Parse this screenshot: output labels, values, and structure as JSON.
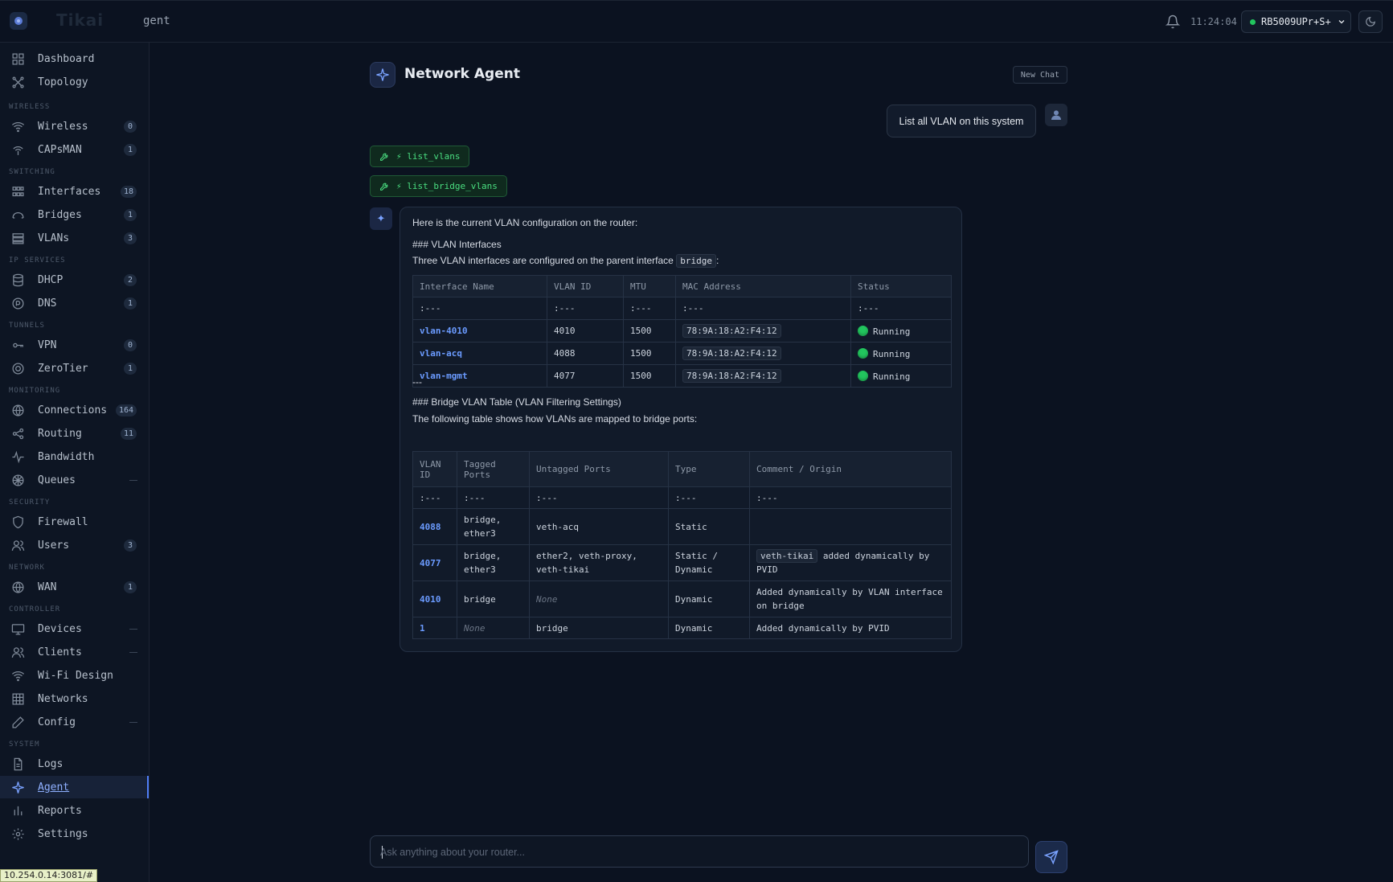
{
  "app": {
    "logo_text": "Tikai",
    "breadcrumb": "gent",
    "clock": "11:24:04",
    "device": "RB5009UPr+S+"
  },
  "sidebar": {
    "top_items": [
      {
        "label": "Dashboard",
        "icon": "dashboard-icon"
      },
      {
        "label": "Topology",
        "icon": "topology-icon"
      }
    ],
    "sections": [
      {
        "title": "WIRELESS",
        "items": [
          {
            "label": "Wireless",
            "count": "0",
            "icon": "wifi-icon"
          },
          {
            "label": "CAPsMAN",
            "count": "1",
            "icon": "antenna-icon"
          }
        ]
      },
      {
        "title": "SWITCHING",
        "items": [
          {
            "label": "Interfaces",
            "count": "18",
            "icon": "interfaces-icon"
          },
          {
            "label": "Bridges",
            "count": "1",
            "icon": "bridge-icon"
          },
          {
            "label": "VLANs",
            "count": "3",
            "icon": "vlan-icon"
          }
        ]
      },
      {
        "title": "IP SERVICES",
        "items": [
          {
            "label": "DHCP",
            "count": "2",
            "icon": "database-icon"
          },
          {
            "label": "DNS",
            "count": "1",
            "icon": "dns-icon"
          }
        ]
      },
      {
        "title": "TUNNELS",
        "items": [
          {
            "label": "VPN",
            "count": "0",
            "icon": "key-icon"
          },
          {
            "label": "ZeroTier",
            "count": "1",
            "icon": "target-icon"
          }
        ]
      },
      {
        "title": "MONITORING",
        "items": [
          {
            "label": "Connections",
            "count": "164",
            "icon": "globe-icon"
          },
          {
            "label": "Routing",
            "count": "11",
            "icon": "share-icon"
          },
          {
            "label": "Bandwidth",
            "count": "",
            "icon": "activity-icon"
          },
          {
            "label": "Queues",
            "count": "—",
            "icon": "queue-icon"
          }
        ]
      },
      {
        "title": "SECURITY",
        "items": [
          {
            "label": "Firewall",
            "count": "",
            "icon": "shield-icon"
          },
          {
            "label": "Users",
            "count": "3",
            "icon": "users-icon"
          }
        ]
      },
      {
        "title": "NETWORK",
        "items": [
          {
            "label": "WAN",
            "count": "1",
            "icon": "globe-icon"
          }
        ]
      },
      {
        "title": "CONTROLLER",
        "items": [
          {
            "label": "Devices",
            "count": "—",
            "icon": "monitor-icon"
          },
          {
            "label": "Clients",
            "count": "—",
            "icon": "users-icon"
          },
          {
            "label": "Wi-Fi Design",
            "count": "",
            "icon": "wifi-icon"
          },
          {
            "label": "Networks",
            "count": "",
            "icon": "grid-icon"
          },
          {
            "label": "Config",
            "count": "—",
            "icon": "pen-icon"
          }
        ]
      },
      {
        "title": "SYSTEM",
        "items": [
          {
            "label": "Logs",
            "count": "",
            "icon": "file-icon"
          },
          {
            "label": "Agent",
            "count": "",
            "icon": "sparkle-icon",
            "active": true
          },
          {
            "label": "Reports",
            "count": "",
            "icon": "bar-chart-icon"
          },
          {
            "label": "Settings",
            "count": "",
            "icon": "gear-icon"
          }
        ]
      }
    ],
    "status_url": "10.254.0.14:3081/#"
  },
  "chat": {
    "title": "Network Agent",
    "new_chat": "New Chat",
    "user_message": "List all VLAN on this system",
    "tool_calls": [
      "⚡ list_vlans",
      "⚡ list_bridge_vlans"
    ],
    "reply": {
      "intro": "Here is the current VLAN configuration on the router:",
      "h1": "### VLAN Interfaces",
      "p1_pre": "Three VLAN interfaces are configured on the parent interface",
      "p1_code": "bridge",
      "p1_post": ":",
      "table1": {
        "headers": [
          "Interface Name",
          "VLAN ID",
          "MTU",
          "MAC Address",
          "Status"
        ],
        "align_row": [
          ":---",
          ":---",
          ":---",
          ":---",
          ":---"
        ],
        "rows": [
          [
            "vlan-4010",
            "4010",
            "1500",
            "78:9A:18:A2:F4:12",
            "Running"
          ],
          [
            "vlan-acq",
            "4088",
            "1500",
            "78:9A:18:A2:F4:12",
            "Running"
          ],
          [
            "vlan-mgmt",
            "4077",
            "1500",
            "78:9A:18:A2:F4:12",
            "Running"
          ]
        ]
      },
      "hr": "---",
      "h2": "### Bridge VLAN Table (VLAN Filtering Settings)",
      "p2": "The following table shows how VLANs are mapped to bridge ports:",
      "table2": {
        "headers": [
          "VLAN ID",
          "Tagged Ports",
          "Untagged Ports",
          "Type",
          "Comment / Origin"
        ],
        "align_row": [
          ":---",
          ":---",
          ":---",
          ":---",
          ":---"
        ],
        "rows": [
          {
            "id": "4088",
            "tagged": "bridge, ether3",
            "untagged": "veth-acq",
            "type": "Static",
            "comment_code": "",
            "comment": ""
          },
          {
            "id": "4077",
            "tagged": "bridge, ether3",
            "untagged": "ether2, veth-proxy, veth-tikai",
            "type": "Static / Dynamic",
            "comment_code": "veth-tikai",
            "comment": "added dynamically by PVID"
          },
          {
            "id": "4010",
            "tagged": "bridge",
            "untagged": "None",
            "type": "Dynamic",
            "comment_code": "",
            "comment": "Added dynamically by VLAN interface on bridge"
          },
          {
            "id": "1",
            "tagged": "None",
            "untagged": "bridge",
            "type": "Dynamic",
            "comment_code": "",
            "comment": "Added dynamically by PVID"
          }
        ]
      }
    },
    "input_placeholder": "Ask anything about your router..."
  },
  "colors": {
    "accent": "#4f7df5",
    "success": "#22c55e",
    "background": "#0b1220"
  }
}
